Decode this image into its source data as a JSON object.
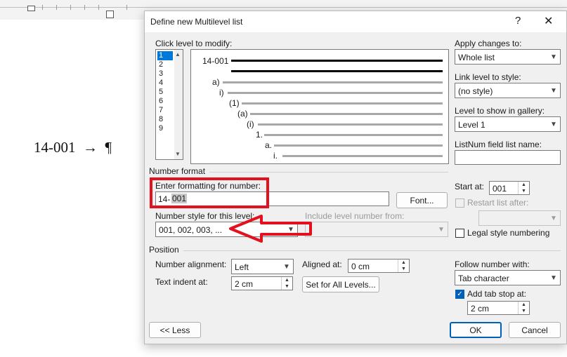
{
  "document": {
    "text": "14-001  →  ¶"
  },
  "dialog": {
    "title": "Define new Multilevel list",
    "help": "?",
    "close": "✕",
    "click_level_label": "Click level to modify:",
    "levels": [
      "1",
      "2",
      "3",
      "4",
      "5",
      "6",
      "7",
      "8",
      "9"
    ],
    "preview": {
      "first": "14-001",
      "numbers": [
        "a)",
        "i)",
        "(1)",
        "(a)",
        "(i)",
        "1.",
        "a.",
        "i."
      ]
    },
    "apply_changes_label": "Apply changes to:",
    "apply_changes_value": "Whole list",
    "link_level_label": "Link level to style:",
    "link_level_value": "(no style)",
    "gallery_label": "Level to show in gallery:",
    "gallery_value": "Level 1",
    "listnum_label": "ListNum field list name:",
    "listnum_value": "",
    "number_format_section": "Number format",
    "enter_formatting_label": "Enter formatting for number:",
    "formatting_prefix": "14-",
    "formatting_field": "001",
    "font_button": "Font...",
    "start_at_label": "Start at:",
    "start_at_value": "001",
    "restart_label": "Restart list after:",
    "number_style_label": "Number style for this level:",
    "number_style_value": "001, 002, 003, ...",
    "include_level_label": "Include level number from:",
    "legal_style_label": "Legal style numbering",
    "position_section": "Position",
    "number_alignment_label": "Number alignment:",
    "number_alignment_value": "Left",
    "aligned_at_label": "Aligned at:",
    "aligned_at_value": "0 cm",
    "text_indent_label": "Text indent at:",
    "text_indent_value": "2 cm",
    "set_all_levels_button": "Set for All Levels...",
    "follow_number_label": "Follow number with:",
    "follow_number_value": "Tab character",
    "add_tab_stop_label": "Add tab stop at:",
    "tab_stop_value": "2 cm",
    "less_button": "<< Less",
    "ok_button": "OK",
    "cancel_button": "Cancel"
  },
  "colors": {
    "annotation": "#e3101d",
    "accent": "#005fb8",
    "selection": "#0078d7"
  }
}
